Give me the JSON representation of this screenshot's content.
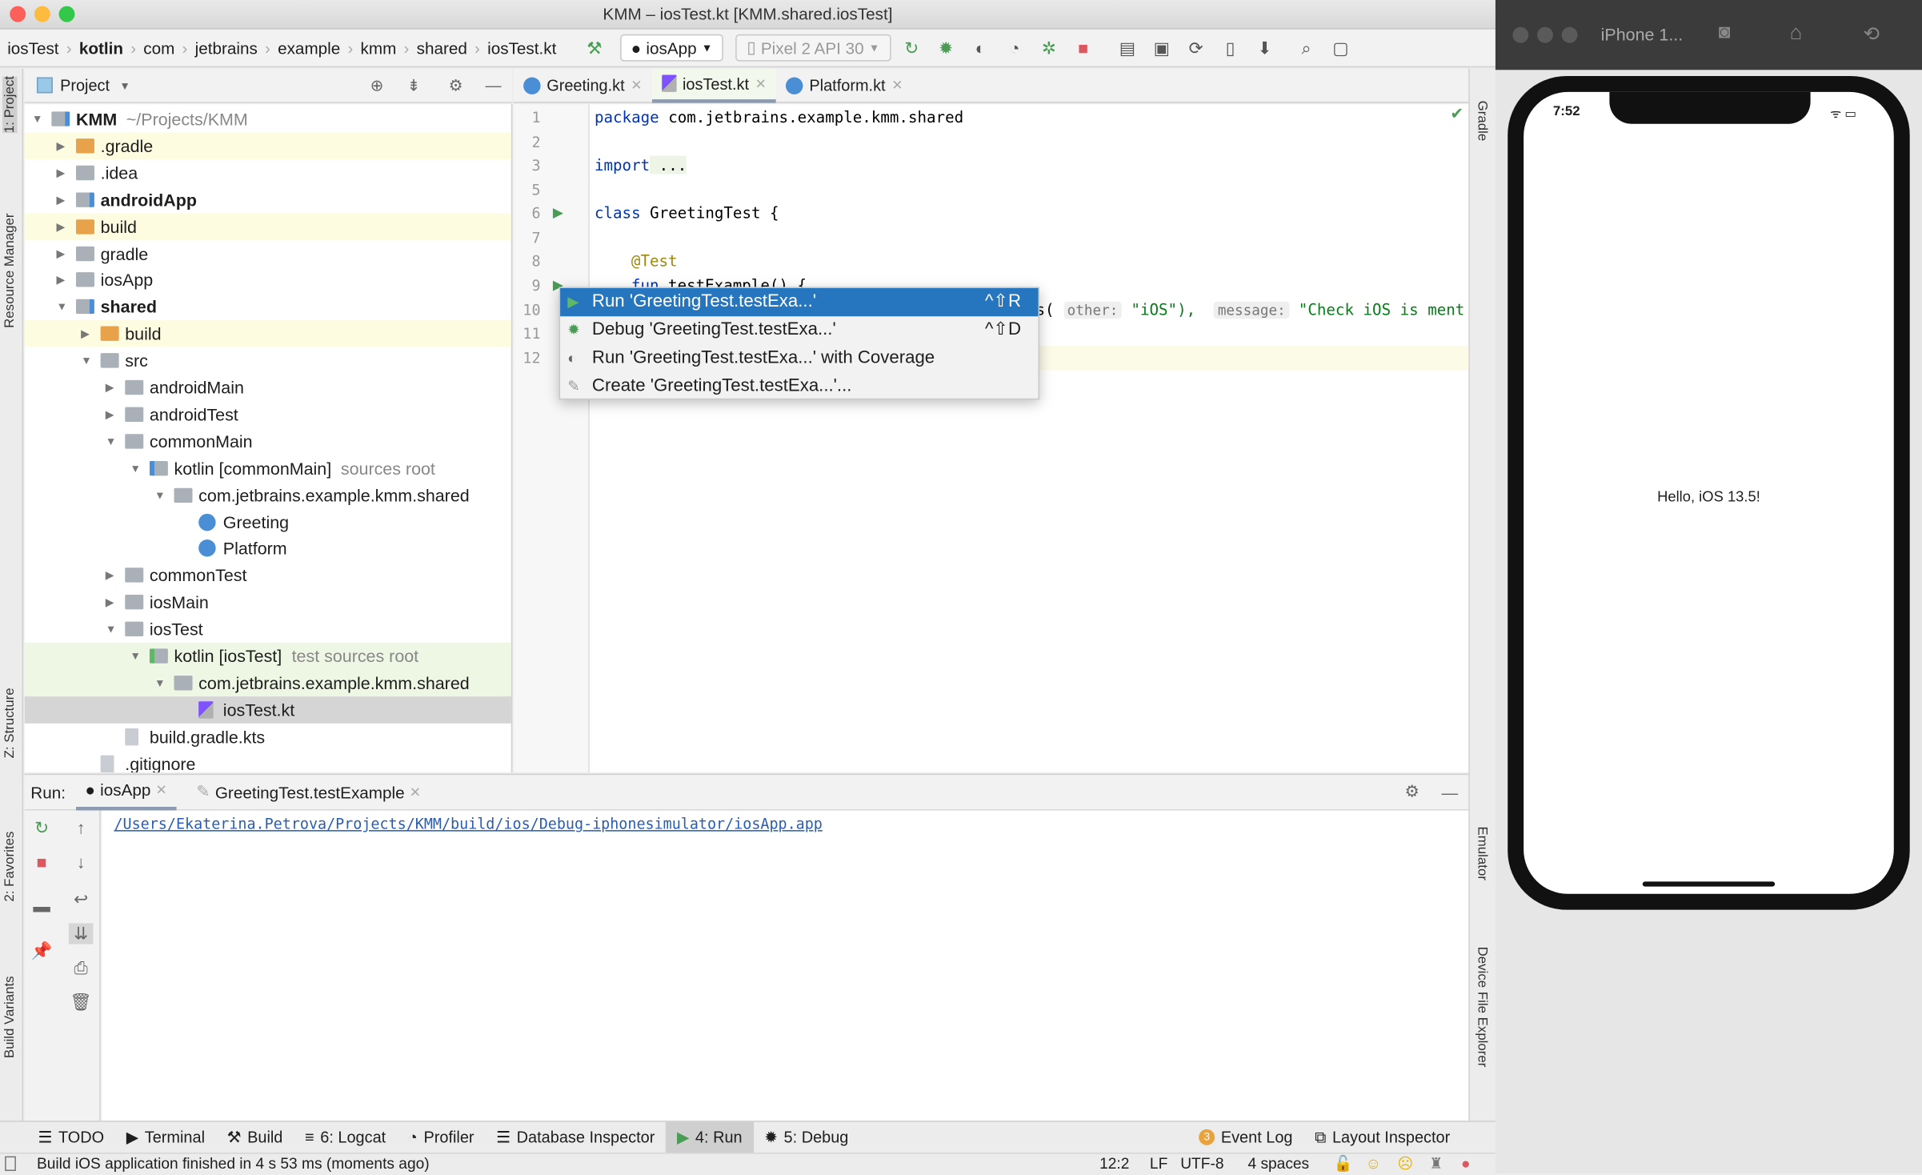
{
  "window": {
    "title": "KMM – iosTest.kt [KMM.shared.iosTest]"
  },
  "breadcrumbs": [
    "iosTest",
    "kotlin",
    "com",
    "jetbrains",
    "example",
    "kmm",
    "shared",
    "iosTest.kt"
  ],
  "toolbar": {
    "run_config": "iosApp",
    "device": "Pixel 2 API 30"
  },
  "left_strip": {
    "project": "1: Project",
    "resource_manager": "Resource Manager",
    "structure": "Z: Structure",
    "favorites": "2: Favorites",
    "build_variants": "Build Variants"
  },
  "right_strip": {
    "gradle": "Gradle",
    "emulator": "Emulator",
    "device_file_explorer": "Device File Explorer"
  },
  "project_panel": {
    "title": "Project"
  },
  "tree": [
    {
      "label": "KMM",
      "hint": "~/Projects/KMM",
      "bold": true,
      "level": 0,
      "arrow": "open",
      "icon": "module"
    },
    {
      "label": ".gradle",
      "level": 1,
      "arrow": "closed",
      "icon": "orange-folder",
      "bg": "yellow"
    },
    {
      "label": ".idea",
      "level": 1,
      "arrow": "closed",
      "icon": "folder"
    },
    {
      "label": "androidApp",
      "bold": true,
      "level": 1,
      "arrow": "closed",
      "icon": "module"
    },
    {
      "label": "build",
      "level": 1,
      "arrow": "closed",
      "icon": "orange-folder",
      "bg": "yellow"
    },
    {
      "label": "gradle",
      "level": 1,
      "arrow": "closed",
      "icon": "folder"
    },
    {
      "label": "iosApp",
      "level": 1,
      "arrow": "closed",
      "icon": "folder"
    },
    {
      "label": "shared",
      "bold": true,
      "level": 1,
      "arrow": "open",
      "icon": "module"
    },
    {
      "label": "build",
      "level": 2,
      "arrow": "closed",
      "icon": "orange-folder",
      "bg": "yellow"
    },
    {
      "label": "src",
      "level": 2,
      "arrow": "open",
      "icon": "folder"
    },
    {
      "label": "androidMain",
      "level": 3,
      "arrow": "closed",
      "icon": "folder"
    },
    {
      "label": "androidTest",
      "level": 3,
      "arrow": "closed",
      "icon": "folder"
    },
    {
      "label": "commonMain",
      "level": 3,
      "arrow": "open",
      "icon": "folder"
    },
    {
      "label": "kotlin [commonMain]",
      "hint": "sources root",
      "level": 4,
      "arrow": "open",
      "icon": "source-folder"
    },
    {
      "label": "com.jetbrains.example.kmm.shared",
      "level": 5,
      "arrow": "open",
      "icon": "folder"
    },
    {
      "label": "Greeting",
      "level": 6,
      "icon": "kotlin-class"
    },
    {
      "label": "Platform",
      "level": 6,
      "icon": "kotlin-class"
    },
    {
      "label": "commonTest",
      "level": 3,
      "arrow": "closed",
      "icon": "folder"
    },
    {
      "label": "iosMain",
      "level": 3,
      "arrow": "closed",
      "icon": "folder"
    },
    {
      "label": "iosTest",
      "level": 3,
      "arrow": "open",
      "icon": "folder"
    },
    {
      "label": "kotlin [iosTest]",
      "hint": "test sources root",
      "level": 4,
      "arrow": "open",
      "icon": "test-folder",
      "bg": "green"
    },
    {
      "label": "com.jetbrains.example.kmm.shared",
      "level": 5,
      "arrow": "open",
      "icon": "folder",
      "bg": "green"
    },
    {
      "label": "iosTest.kt",
      "level": 6,
      "icon": "kotlin-file",
      "bg": "selected"
    },
    {
      "label": "build.gradle.kts",
      "level": 3,
      "icon": "gradle-file",
      "noarrow": true
    },
    {
      "label": ".gitignore",
      "level": 2,
      "icon": "file",
      "noarrow": true
    }
  ],
  "editor_tabs": [
    {
      "label": "Greeting.kt",
      "icon": "kotlin-class"
    },
    {
      "label": "iosTest.kt",
      "icon": "kotlin-file",
      "active": true
    },
    {
      "label": "Platform.kt",
      "icon": "kotlin-class"
    }
  ],
  "code": {
    "line_numbers": [
      "1",
      "2",
      "3",
      "5",
      "6",
      "7",
      "8",
      "9",
      "10",
      "11",
      "12"
    ],
    "l1_kw": "package",
    "l1_rest": " com.jetbrains.example.kmm.shared",
    "l3_kw": "import",
    "l3_rest": " ...",
    "l6_kw": "class",
    "l6_rest": " GreetingTest {",
    "l8": "@Test",
    "l9_kw": "fun",
    "l9_rest": " testExample() {",
    "l10_a": "s(",
    "l10_hint1": "other:",
    "l10_b": "\"iOS\"),",
    "l10_hint2": "message:",
    "l10_c": "\"Check iOS is ment"
  },
  "popup": {
    "items": [
      {
        "label": "Run 'GreetingTest.testExa...'",
        "shortcut": "^⇧R",
        "icon": "run-icon",
        "selected": true
      },
      {
        "label": "Debug 'GreetingTest.testExa...'",
        "shortcut": "^⇧D",
        "icon": "debug-icon"
      },
      {
        "label": "Run 'GreetingTest.testExa...' with Coverage",
        "shortcut": "",
        "icon": "coverage-icon"
      },
      {
        "label": "Create 'GreetingTest.testExa...'...",
        "shortcut": "",
        "icon": "create-config-icon"
      }
    ]
  },
  "run_panel": {
    "label": "Run:",
    "tabs": [
      "iosApp",
      "GreetingTest.testExample"
    ],
    "output_link": "/Users/Ekaterina.Petrova/Projects/KMM/build/ios/Debug-iphonesimulator/iosApp.app"
  },
  "bottom_tools": [
    "TODO",
    "Terminal",
    "Build",
    "6: Logcat",
    "Profiler",
    "Database Inspector",
    "4: Run",
    "5: Debug"
  ],
  "event_log": {
    "label": "Event Log",
    "count": "3"
  },
  "layout_inspector": "Layout Inspector",
  "status": {
    "message": "Build iOS application finished in 4 s 53 ms (moments ago)",
    "position": "12:2",
    "line_sep": "LF",
    "encoding": "UTF-8",
    "indent": "4 spaces"
  },
  "simulator": {
    "title": "iPhone 1...",
    "time": "7:52",
    "content": "Hello, iOS 13.5!"
  },
  "colors": {
    "accent": "#2675bf",
    "run_green": "#499c54",
    "stop_red": "#db5860"
  }
}
